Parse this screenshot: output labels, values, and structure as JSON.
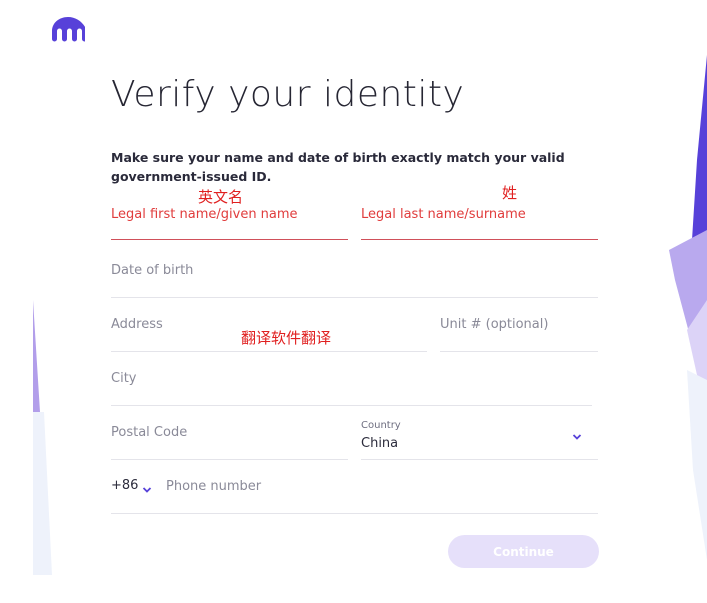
{
  "brand": {
    "logo_icon": "kraken-logo-icon",
    "color": "#5741d9"
  },
  "page": {
    "title": "Verify your identity",
    "subtitle": "Make sure your name and date of birth exactly match your valid government-issued ID."
  },
  "annotations": {
    "first_name": "英文名",
    "last_name": "姓",
    "address": "翻译软件翻译"
  },
  "form": {
    "first_name_label": "Legal first name/given name",
    "last_name_label": "Legal last name/surname",
    "dob_label": "Date of birth",
    "address_label": "Address",
    "unit_label": "Unit # (optional)",
    "city_label": "City",
    "postal_label": "Postal Code",
    "country_caption": "Country",
    "country_value": "China",
    "dial_code": "+86",
    "phone_placeholder": "Phone number",
    "continue_label": "Continue"
  },
  "colors": {
    "error": "#e03c3c",
    "accent": "#5741d9",
    "button_disabled": "#e6e0fa"
  }
}
